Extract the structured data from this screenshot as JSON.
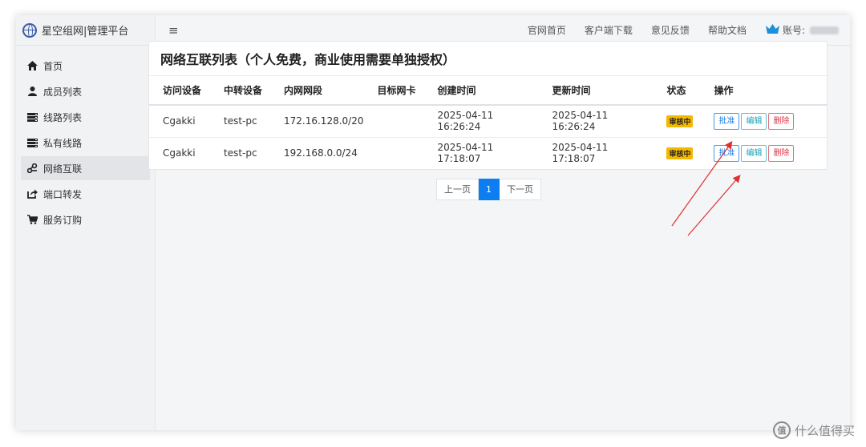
{
  "brand": {
    "title": "星空组网|管理平台"
  },
  "sidebar": {
    "items": [
      {
        "label": "首页",
        "icon": "home-icon"
      },
      {
        "label": "成员列表",
        "icon": "user-icon"
      },
      {
        "label": "线路列表",
        "icon": "server-icon"
      },
      {
        "label": "私有线路",
        "icon": "server-icon"
      },
      {
        "label": "网络互联",
        "icon": "network-icon",
        "active": true
      },
      {
        "label": "端口转发",
        "icon": "share-icon"
      },
      {
        "label": "服务订购",
        "icon": "cart-icon"
      }
    ]
  },
  "topbar": {
    "menu_icon": "≡",
    "links": [
      "官网首页",
      "客户端下载",
      "意见反馈",
      "帮助文档"
    ],
    "account_label": "账号:"
  },
  "card": {
    "title": "网络互联列表（个人免费，商业使用需要单独授权）",
    "columns": [
      "访问设备",
      "中转设备",
      "内网网段",
      "目标网卡",
      "创建时间",
      "更新时间",
      "状态",
      "操作"
    ],
    "rows": [
      {
        "access": "Cgakki",
        "relay": "test-pc",
        "subnet": "172.16.128.0/20",
        "nic": "",
        "created": "2025-04-11 16:26:24",
        "updated": "2025-04-11 16:26:24",
        "status": "审核中"
      },
      {
        "access": "Cgakki",
        "relay": "test-pc",
        "subnet": "192.168.0.0/24",
        "nic": "",
        "created": "2025-04-11 17:18:07",
        "updated": "2025-04-11 17:18:07",
        "status": "审核中"
      }
    ],
    "actions": {
      "approve": "批准",
      "edit": "编辑",
      "delete": "删除"
    }
  },
  "pagination": {
    "prev": "上一页",
    "current": "1",
    "next": "下一页"
  },
  "watermark": {
    "text": "什么值得买",
    "icon_text": "值"
  },
  "colors": {
    "accent": "#0d7ef2",
    "badge": "#f5b800",
    "arrow": "#e03030"
  }
}
